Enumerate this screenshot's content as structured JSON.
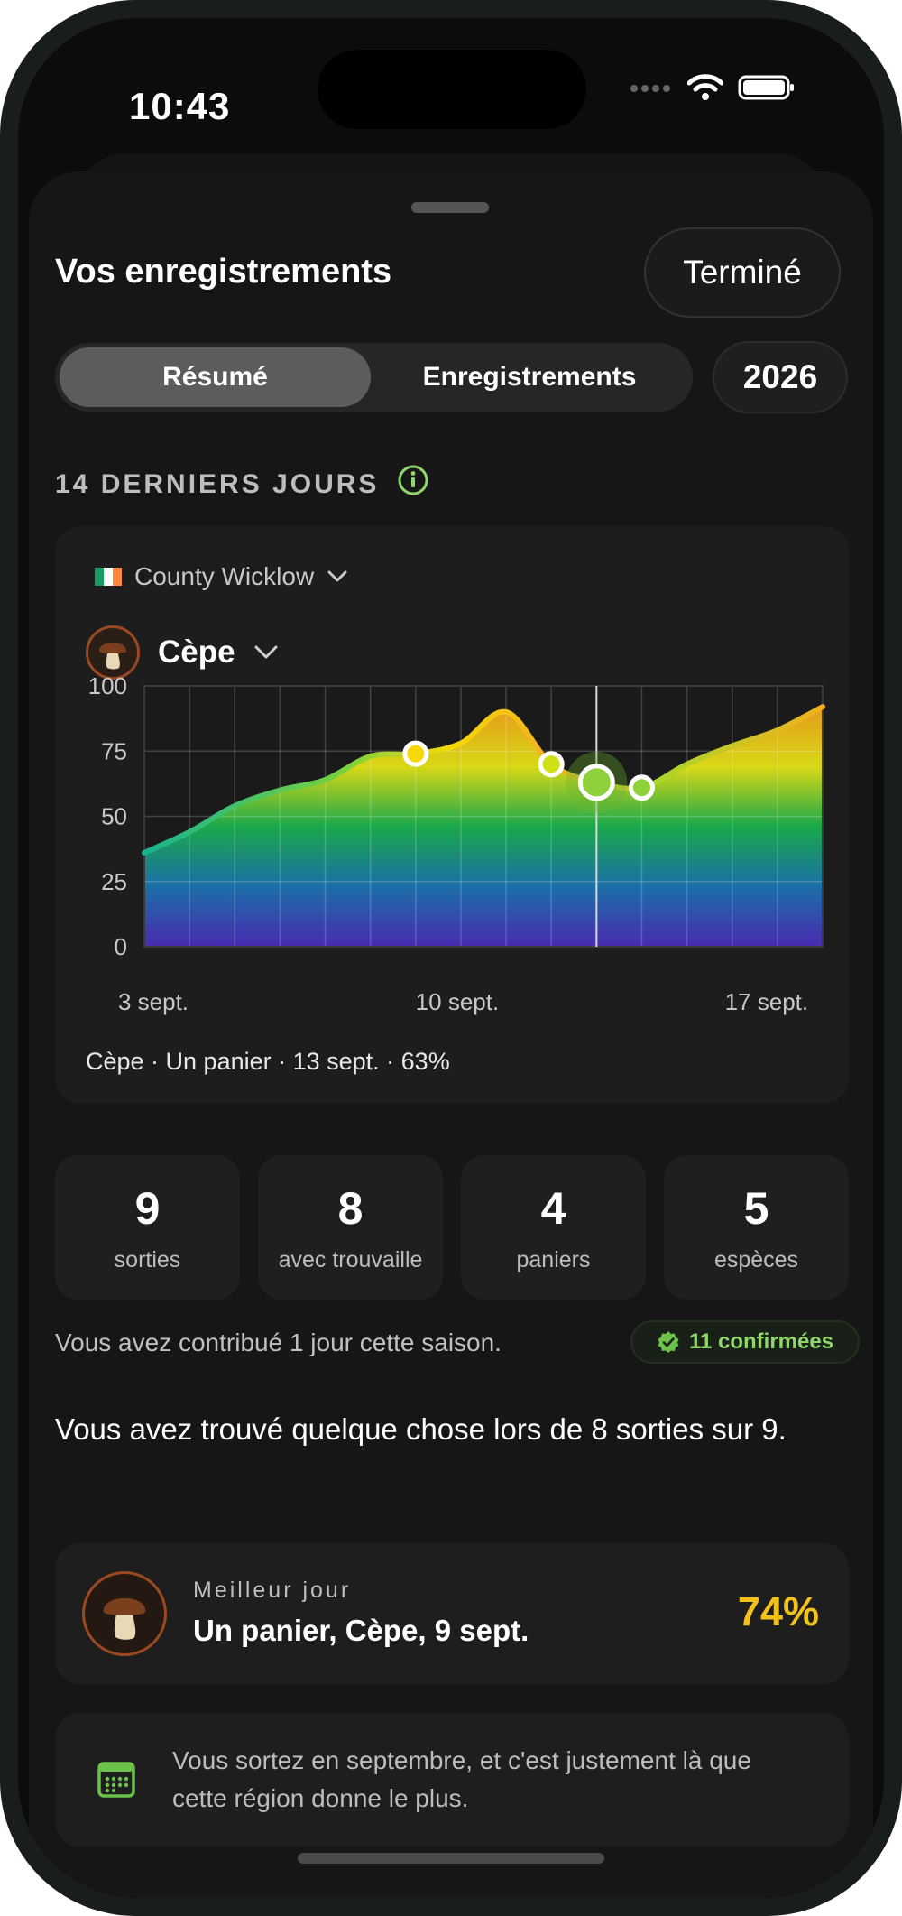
{
  "status_bar": {
    "time": "10:43"
  },
  "sheet": {
    "title": "Vos enregistrements",
    "done_label": "Terminé",
    "tabs": [
      {
        "label": "Résumé",
        "active": true
      },
      {
        "label": "Enregistrements",
        "active": false
      }
    ],
    "year": "2026"
  },
  "section": {
    "heading": "14 DERNIERS JOURS"
  },
  "filters": {
    "region": "County Wicklow",
    "region_flag": "ireland-flag",
    "species": "Cèpe",
    "species_icon": "mushroom-icon"
  },
  "chart_data": {
    "type": "area",
    "title": "",
    "xlabel": "",
    "ylabel": "",
    "ylim": [
      0,
      100
    ],
    "y_ticks": [
      "100",
      "75",
      "50",
      "25",
      "0"
    ],
    "x_tick_labels": [
      {
        "day": 3,
        "label": "3 sept."
      },
      {
        "day": 10,
        "label": "10 sept."
      },
      {
        "day": 17,
        "label": "17 sept."
      }
    ],
    "x": [
      3,
      4,
      5,
      6,
      7,
      8,
      9,
      10,
      11,
      12,
      13,
      14,
      15,
      16,
      17,
      18
    ],
    "values": [
      36,
      44,
      54,
      60,
      64,
      73,
      74,
      78,
      90,
      70,
      63,
      61,
      70,
      77,
      83,
      92
    ],
    "markers": [
      {
        "x": 9,
        "y": 74,
        "color": "#f5d90a"
      },
      {
        "x": 12,
        "y": 70,
        "color": "#cfe016"
      },
      {
        "x": 13,
        "y": 63,
        "color": "#8fd13a",
        "selected": true
      },
      {
        "x": 14,
        "y": 61,
        "color": "#8fd13a"
      }
    ],
    "selected_x": 13,
    "gradient_colors": [
      "#f0a21b",
      "#d8d816",
      "#19a84b",
      "#1b6fa8",
      "#4a2ab0"
    ],
    "grid": true,
    "caption": "Cèpe · Un panier · 13 sept. · 63%"
  },
  "stats": [
    {
      "value": "9",
      "label": "sorties"
    },
    {
      "value": "8",
      "label": "avec trouvaille"
    },
    {
      "value": "4",
      "label": "paniers"
    },
    {
      "value": "5",
      "label": "espèces"
    }
  ],
  "contribution": {
    "text": "Vous avez contribué 1 jour cette saison.",
    "badge": "11 confirmées",
    "badge_color": "#8fd66b"
  },
  "summary_text": "Vous avez trouvé quelque chose lors de 8 sorties sur 9.",
  "best_day": {
    "label": "Meilleur jour",
    "title": "Un panier, Cèpe, 9 sept.",
    "percent": "74%",
    "percent_color": "#f2c21b"
  },
  "tip": {
    "icon": "calendar-icon",
    "text": "Vous sortez en septembre, et c'est justement là que cette région donne le plus."
  }
}
